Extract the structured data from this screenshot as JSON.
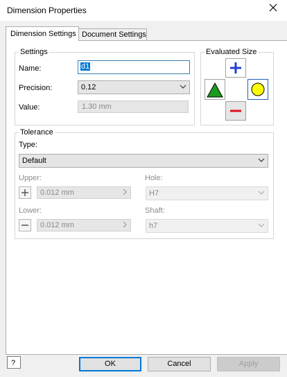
{
  "window": {
    "title": "Dimension Properties"
  },
  "tabs": [
    {
      "label": "Dimension Settings",
      "active": true
    },
    {
      "label": "Document Settings",
      "active": false
    }
  ],
  "settings": {
    "group_label": "Settings",
    "name_label": "Name:",
    "name_value": "d1",
    "precision_label": "Precision:",
    "precision_value": "0.12",
    "value_label": "Value:",
    "value_value": "1.30 mm"
  },
  "evaluated_size": {
    "group_label": "Evaluated Size",
    "icons": [
      "plus-icon",
      "minus-icon",
      "triangle-icon",
      "circle-icon"
    ],
    "colors": {
      "plus": "#1f3fd1",
      "minus": "#e0101a",
      "triangle": "#1c9a1c",
      "circle": "#ffff00"
    }
  },
  "tolerance": {
    "group_label": "Tolerance",
    "type_label": "Type:",
    "type_value": "Default",
    "upper_label": "Upper:",
    "upper_value": "0.012 mm",
    "lower_label": "Lower:",
    "lower_value": "0.012 mm",
    "hole_label": "Hole:",
    "hole_value": "H7",
    "shaft_label": "Shaft:",
    "shaft_value": "h7"
  },
  "footer": {
    "help_icon": "help-icon",
    "ok_label": "OK",
    "cancel_label": "Cancel",
    "apply_label": "Apply"
  }
}
